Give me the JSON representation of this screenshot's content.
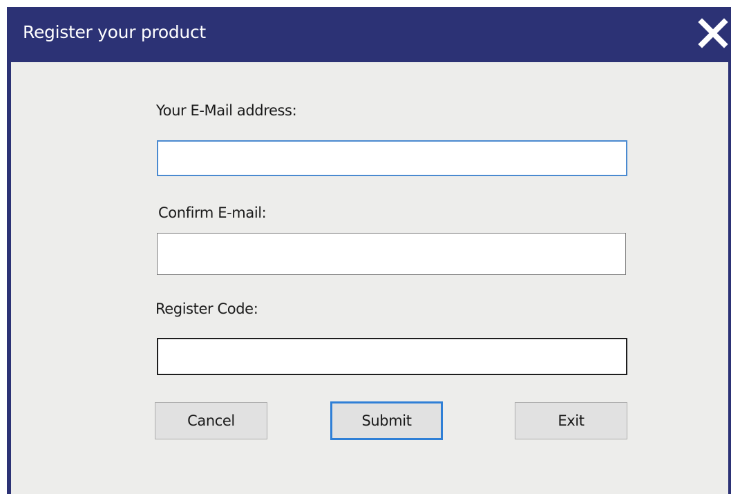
{
  "window": {
    "title": "Register your product"
  },
  "form": {
    "email_label": "Your E-Mail address:",
    "email_value": "",
    "confirm_label": "Confirm E-mail:",
    "confirm_value": "",
    "code_label": "Register Code:",
    "code_value": ""
  },
  "buttons": {
    "cancel": "Cancel",
    "submit": "Submit",
    "exit": "Exit"
  },
  "icons": {
    "close": "close-icon"
  },
  "colors": {
    "titlebar": "#2c3275",
    "background": "#ededeb",
    "focus_accent": "#4a8ad0",
    "default_button_border": "#2f7fd6"
  }
}
